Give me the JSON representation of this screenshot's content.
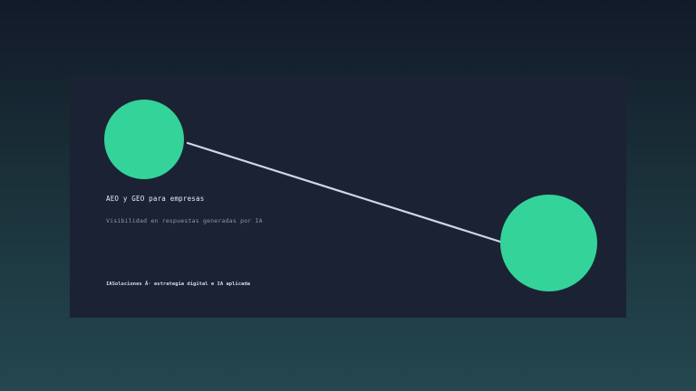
{
  "slide": {
    "title": "AEO y GEO para empresas",
    "subtitle": "Visibilidad en respuestas generadas por IA",
    "footer": "IASoluciones Â· estrategia digital e IA aplicada"
  },
  "colors": {
    "background_top": "#121a29",
    "background_bottom": "#244750",
    "card": "#1b2234",
    "accent": "#34d399",
    "connector": "#cfd6e6"
  }
}
